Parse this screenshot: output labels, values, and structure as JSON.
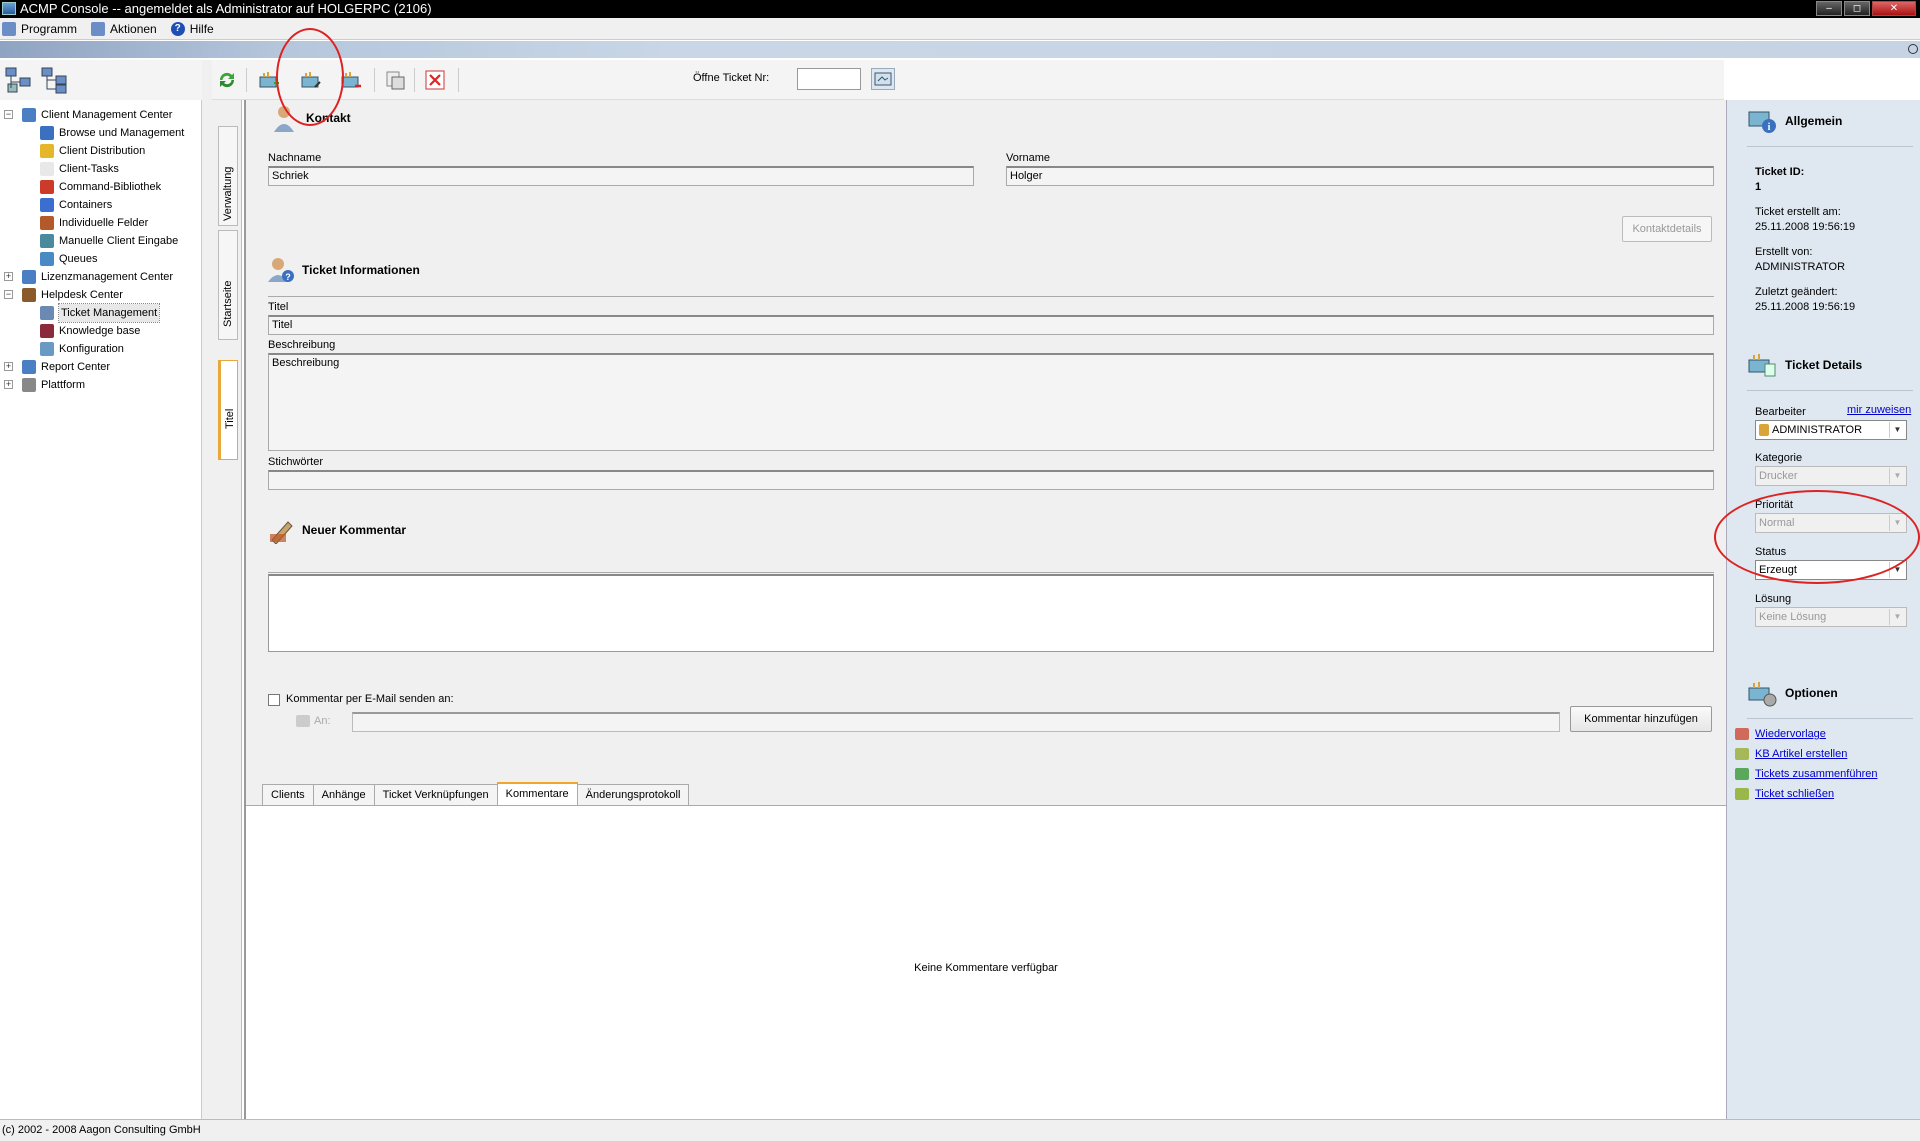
{
  "window": {
    "title": "ACMP Console -- angemeldet als Administrator auf HOLGERPC (2106)",
    "minimize": "‒",
    "maximize": "◻",
    "close": "✕"
  },
  "menu": [
    "Programm",
    "Aktionen",
    "Hilfe"
  ],
  "tree": [
    {
      "label": "Client Management Center",
      "level": 0,
      "expand": "−",
      "color": "#4a7fc4"
    },
    {
      "label": "Browse und Management",
      "level": 1,
      "color": "#3b6fc0"
    },
    {
      "label": "Client Distribution",
      "level": 1,
      "color": "#e5b52a"
    },
    {
      "label": "Client-Tasks",
      "level": 1,
      "color": "#e8e8e8"
    },
    {
      "label": "Command-Bibliothek",
      "level": 1,
      "color": "#cc3a2a"
    },
    {
      "label": "Containers",
      "level": 1,
      "color": "#3a6fd0"
    },
    {
      "label": "Individuelle Felder",
      "level": 1,
      "color": "#b45a2a"
    },
    {
      "label": "Manuelle Client Eingabe",
      "level": 1,
      "color": "#4a8a9c"
    },
    {
      "label": "Queues",
      "level": 1,
      "color": "#4a8ac4"
    },
    {
      "label": "Lizenzmanagement Center",
      "level": 0,
      "expand": "+",
      "color": "#4a7fc4"
    },
    {
      "label": "Helpdesk Center",
      "level": 0,
      "expand": "−",
      "color": "#8a5a2a"
    },
    {
      "label": "Ticket Management",
      "level": 1,
      "color": "#6a8ab4",
      "selected": true
    },
    {
      "label": "Knowledge base",
      "level": 1,
      "color": "#8a2a3a"
    },
    {
      "label": "Konfiguration",
      "level": 1,
      "color": "#6a9ac4"
    },
    {
      "label": "Report Center",
      "level": 0,
      "expand": "+",
      "color": "#4a7fc4"
    },
    {
      "label": "Plattform",
      "level": 0,
      "expand": "+",
      "color": "#888888"
    }
  ],
  "vtabs": {
    "verwaltung": "Verwaltung",
    "startseite": "Startseite",
    "titel": "Titel"
  },
  "toolbar": {
    "open_ticket_label": "Öffne Ticket Nr:",
    "open_ticket_value": ""
  },
  "kontakt": {
    "heading": "Kontakt",
    "nachname_label": "Nachname",
    "nachname": "Schriek",
    "vorname_label": "Vorname",
    "vorname": "Holger",
    "details_button": "Kontaktdetails"
  },
  "ticket_info": {
    "heading": "Ticket Informationen",
    "titel_label": "Titel",
    "titel": "Titel",
    "beschreibung_label": "Beschreibung",
    "beschreibung": "Beschreibung",
    "stichwoerter_label": "Stichwörter",
    "stichwoerter": ""
  },
  "kommentar": {
    "heading": "Neuer Kommentar",
    "email_checkbox": "Kommentar per E-Mail senden an:",
    "an_label": "An:",
    "add_button": "Kommentar hinzufügen"
  },
  "tabs": [
    "Clients",
    "Anhänge",
    "Ticket Verknüpfungen",
    "Kommentare",
    "Änderungsprotokoll"
  ],
  "active_tab": "Kommentare",
  "tab_content_empty": "Keine Kommentare verfügbar",
  "allgemein": {
    "heading": "Allgemein",
    "ticket_id_label": "Ticket ID:",
    "ticket_id": "1",
    "erstellt_am_label": "Ticket erstellt am:",
    "erstellt_am": "25.11.2008 19:56:19",
    "erstellt_von_label": "Erstellt von:",
    "erstellt_von": "ADMINISTRATOR",
    "geaendert_label": "Zuletzt geändert:",
    "geaendert": "25.11.2008 19:56:19"
  },
  "ticket_details": {
    "heading": "Ticket Details",
    "bearbeiter_label": "Bearbeiter",
    "assign_link": "mir zuweisen",
    "bearbeiter": "ADMINISTRATOR",
    "kategorie_label": "Kategorie",
    "kategorie": "Drucker",
    "prioritaet_label": "Priorität",
    "prioritaet": "Normal",
    "status_label": "Status",
    "status": "Erzeugt",
    "loesung_label": "Lösung",
    "loesung": "Keine Lösung"
  },
  "optionen": {
    "heading": "Optionen",
    "links": [
      "Wiedervorlage",
      "KB Artikel erstellen",
      "Tickets zusammenführen",
      "Ticket schließen"
    ]
  },
  "statusbar": "(c) 2002 - 2008 Aagon Consulting GmbH",
  "colors": {
    "annotation": "#d22222",
    "accent_tab": "#f2a52b",
    "right_pane": "#dfe8f1"
  }
}
